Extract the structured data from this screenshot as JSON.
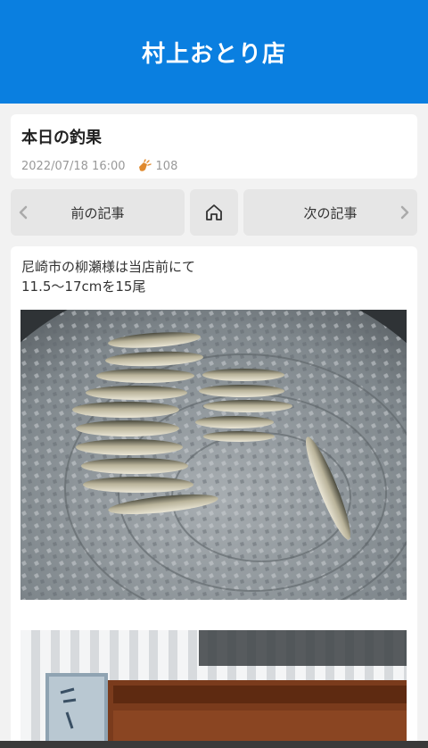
{
  "header": {
    "title": "村上おとり店"
  },
  "post": {
    "title": "本日の釣果",
    "date": "2022/07/18 16:00",
    "clap_count": "108",
    "body": "尼崎市の柳瀬様は当店前にて\n11.5〜17cmを15尾"
  },
  "nav": {
    "prev_label": "前の記事",
    "next_label": "次の記事"
  },
  "photos": [
    {
      "alt": "photo-fish-in-tub"
    },
    {
      "alt": "photo-shop-sign"
    }
  ],
  "colors": {
    "header_bg": "#0a7fe0",
    "page_bg": "#f2f2f2",
    "nav_bg": "#e6e6e6",
    "clap_accent": "#e08a2e"
  },
  "icons": [
    "clap-icon",
    "home-icon",
    "chevron-left-icon",
    "chevron-right-icon"
  ]
}
